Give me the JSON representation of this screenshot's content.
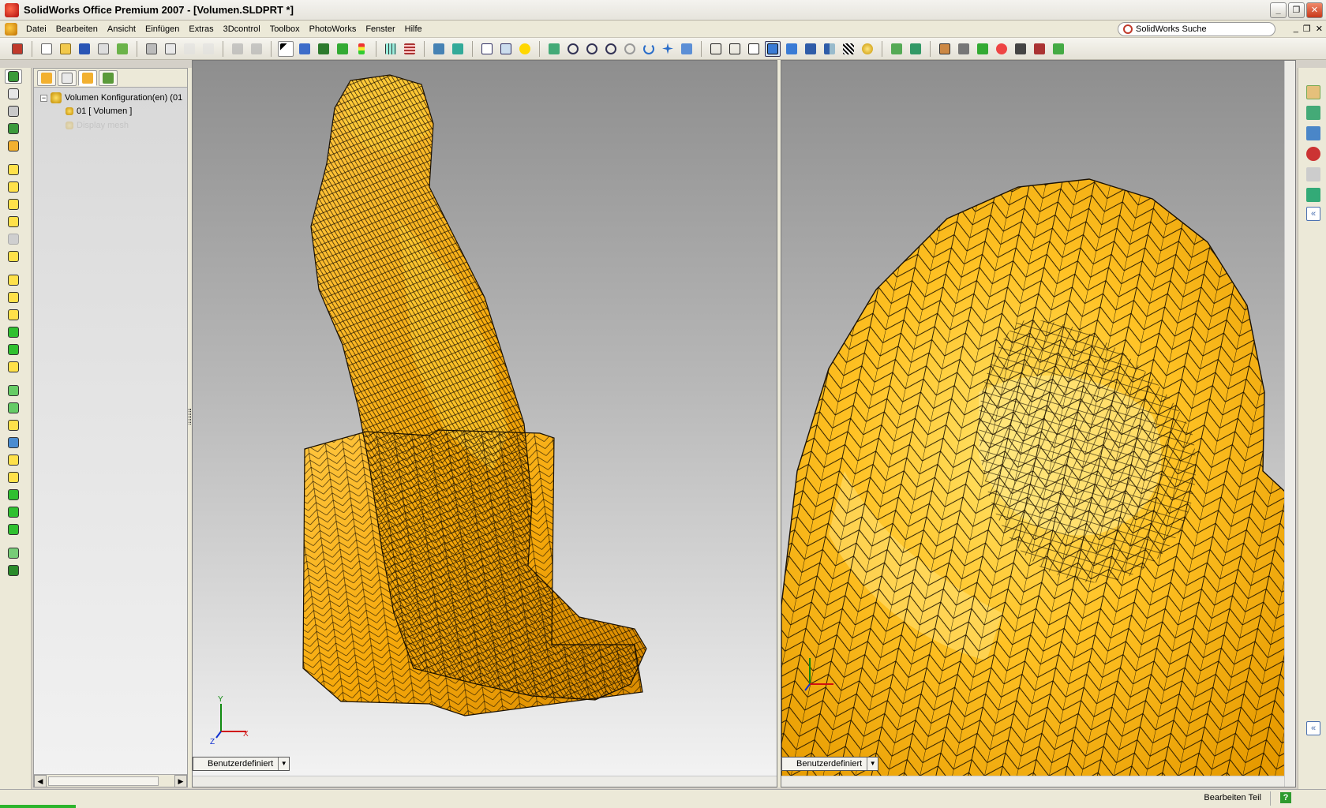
{
  "window": {
    "title": "SolidWorks Office Premium 2007 - [Volumen.SLDPRT *]",
    "minimize": "_",
    "restore": "❐",
    "close": "✕"
  },
  "menu": {
    "items": [
      "Datei",
      "Bearbeiten",
      "Ansicht",
      "Einfügen",
      "Extras",
      "3Dcontrol",
      "Toolbox",
      "PhotoWorks",
      "Fenster",
      "Hilfe"
    ],
    "search_value": "SolidWorks Suche",
    "doc_min": "_",
    "doc_restore": "❐",
    "doc_close": "✕"
  },
  "feature_tree": {
    "root_label": "Volumen Konfiguration(en)  (01",
    "expander": "−",
    "child_label": "01 [ Volumen ]",
    "ghost_label": "Display mesh"
  },
  "viewports": {
    "left_view_label": "Benutzerdefiniert",
    "right_view_label": "Benutzerdefiniert",
    "triad_x": "X",
    "triad_y": "Y",
    "triad_z": "Z"
  },
  "statusbar": {
    "text": "Bearbeiten Teil",
    "help": "?"
  },
  "colors": {
    "model_fill": "#f6a90b",
    "model_highlight": "#ffd23a",
    "mesh_line": "#1a1000",
    "triad_x": "#d01010",
    "triad_y": "#108a10",
    "triad_z": "#1030d0"
  }
}
